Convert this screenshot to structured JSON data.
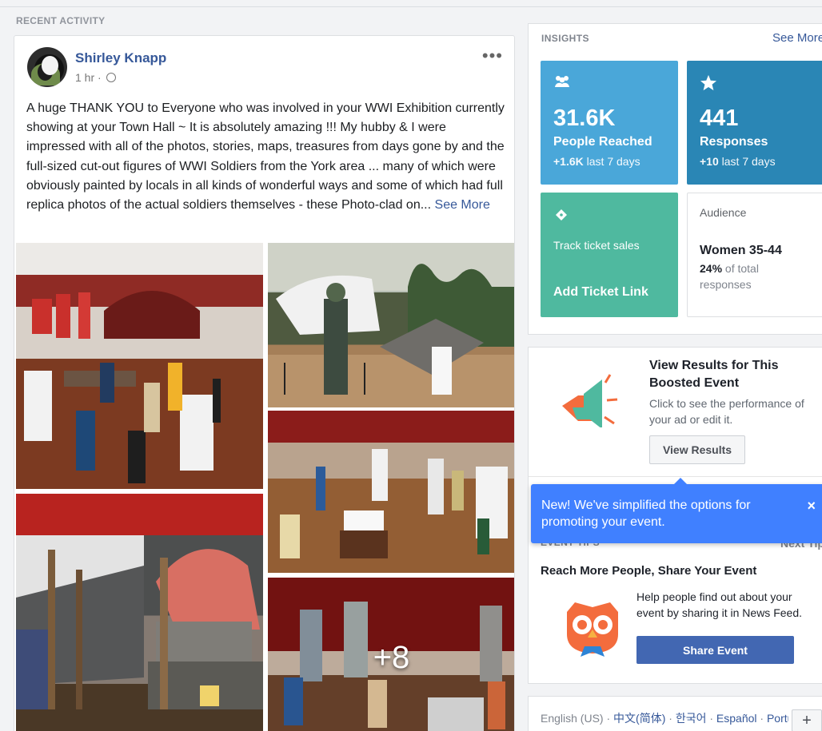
{
  "section": {
    "title": "RECENT ACTIVITY"
  },
  "post": {
    "author": "Shirley Knapp",
    "time": "1 hr ·",
    "text": "A huge THANK YOU to Everyone who was involved in your WWI Exhibition currently showing at your Town Hall ~ It is absolutely amazing !!! My hubby & I were impressed with all of the photos, stories, maps, treasures from days gone by and the full-sized cut-out figures of WWI Soldiers from the York area ... many of which were obviously painted by locals in all kinds of wonderful ways and some of which had full replica photos of the actual soldiers themselves - these Photo-clad on...",
    "see_more": "See More",
    "more_icon": "more-options-icon",
    "photos_extra": "+8"
  },
  "insights": {
    "title": "INSIGHTS",
    "see_more": "See More",
    "reached": {
      "value": "31.6K",
      "label": "People Reached",
      "delta": "+1.6K",
      "delta_label": "last 7 days",
      "icon": "people-icon"
    },
    "responses": {
      "value": "441",
      "label": "Responses",
      "delta": "+10",
      "delta_label": "last 7 days",
      "icon": "star-icon"
    },
    "tickets": {
      "label": "Track ticket sales",
      "link": "Add Ticket Link",
      "icon": "ticket-icon"
    },
    "audience": {
      "label": "Audience",
      "value": "Women 35-44",
      "pct": "24%",
      "pct_label": "of total responses"
    }
  },
  "boost": {
    "title": "View Results for This Boosted Event",
    "desc": "Click to see the performance of your ad or edit it.",
    "button": "View Results",
    "icon": "megaphone-icon"
  },
  "tooltip": {
    "text": "New! We've simplified the options for promoting your event.",
    "close": "×"
  },
  "tips": {
    "header": "EVENT TIPS",
    "next": "Next Tip",
    "title": "Reach More People, Share Your Event",
    "text": "Help people find out about your event by sharing it in News Feed.",
    "button": "Share Event",
    "icon": "owl-icon"
  },
  "languages": {
    "current": "English (US)",
    "sep": " · ",
    "others": [
      "中文(简体)",
      "한국어",
      "Español",
      "Português (Brasil)"
    ],
    "add": "+"
  },
  "colors": {
    "link": "#365899",
    "reached_tile": "#4aa7d9",
    "responses_tile": "#2a86b5",
    "ticket_tile": "#4fb99f",
    "tooltip": "#4080ff",
    "share_button": "#4267b2"
  }
}
